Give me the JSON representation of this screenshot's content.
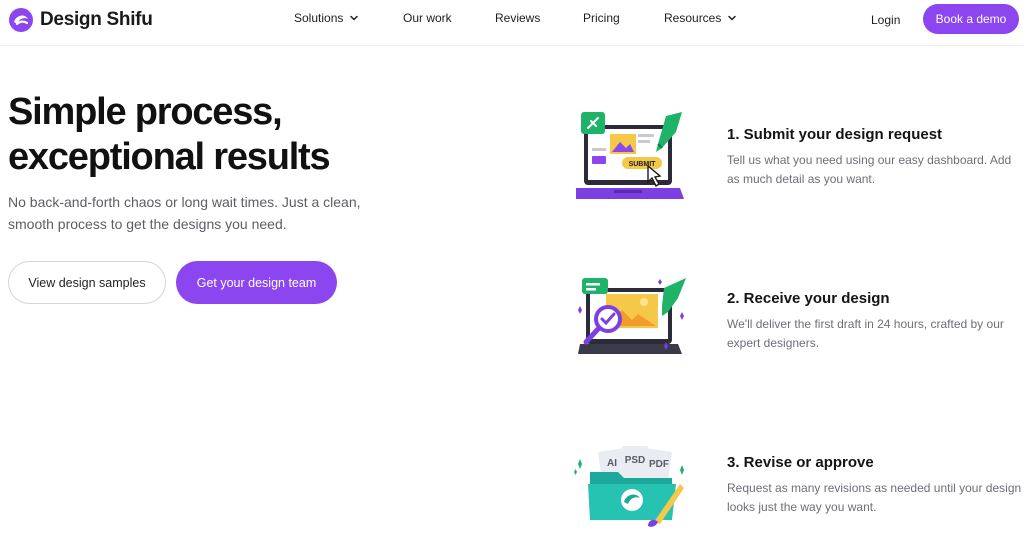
{
  "brand": {
    "name": "Design Shifu",
    "accent": "#8b46f0"
  },
  "nav": {
    "items": [
      {
        "label": "Solutions",
        "has_dropdown": true
      },
      {
        "label": "Our work",
        "has_dropdown": false
      },
      {
        "label": "Reviews",
        "has_dropdown": false
      },
      {
        "label": "Pricing",
        "has_dropdown": false
      },
      {
        "label": "Resources",
        "has_dropdown": true
      }
    ],
    "login": "Login",
    "cta": "Book a demo"
  },
  "hero": {
    "title_line1": "Simple process,",
    "title_line2": "exceptional results",
    "subtitle": "No back-and-forth chaos or long wait times. Just a clean, smooth process to get the designs you need.",
    "secondary_button": "View design samples",
    "primary_button": "Get your design team"
  },
  "steps": [
    {
      "title": "1. Submit your design request",
      "description": "Tell us what you need using our easy dashboard. Add as much detail as you want.",
      "illustration": "laptop-submit",
      "badge": "SUBMIT"
    },
    {
      "title": "2. Receive your design",
      "description": "We'll deliver the first draft in 24 hours, crafted by our expert designers.",
      "illustration": "laptop-review"
    },
    {
      "title": "3. Revise or approve",
      "description": "Request as many revisions as needed until your design looks just the way you want.",
      "illustration": "folder-files",
      "file_tags": [
        "AI",
        "PSD",
        "PDF"
      ]
    }
  ]
}
